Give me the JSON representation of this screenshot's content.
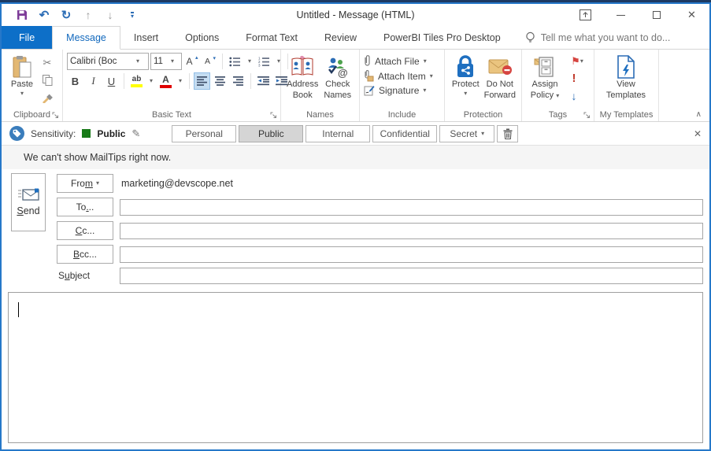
{
  "icons": {
    "dropdown": "▾",
    "undo": "↶",
    "redo": "↻",
    "up_arrow": "↑",
    "down_arrow": "↓",
    "qat_more": "▾",
    "close_window": "✕",
    "cut": "✂",
    "grow_font_letter": "A",
    "shrink_font_letter": "A",
    "grow_caret": "▴",
    "shrink_caret": "▾",
    "highlight_text": "ab",
    "font_color_letter": "A",
    "flag": "⚑",
    "high_importance": "!",
    "low_importance": "↓",
    "pencil": "✎",
    "close_bar": "✕",
    "collapse_ribbon": "∧"
  },
  "titlebar": {
    "title": "Untitled - Message (HTML)"
  },
  "tabs": {
    "file": "File",
    "message": "Message",
    "insert": "Insert",
    "options": "Options",
    "format_text": "Format Text",
    "review": "Review",
    "powerbi": "PowerBI Tiles Pro Desktop",
    "tell_me": "Tell me what you want to do..."
  },
  "ribbon": {
    "paste": "Paste",
    "clipboard_label": "Clipboard",
    "font_name": "Calibri (Boc",
    "font_size": "11",
    "bold": "B",
    "italic": "I",
    "underline": "U",
    "basic_text_label": "Basic Text",
    "address_book_1": "Address",
    "address_book_2": "Book",
    "check_names_1": "Check",
    "check_names_2": "Names",
    "names_label": "Names",
    "attach_file": "Attach File",
    "attach_item": "Attach Item",
    "signature": "Signature",
    "include_label": "Include",
    "protect": "Protect",
    "do_not_forward_1": "Do Not",
    "do_not_forward_2": "Forward",
    "protection_label": "Protection",
    "assign_policy_1": "Assign",
    "assign_policy_2": "Policy",
    "tags_label": "Tags",
    "view_templates_1": "View",
    "view_templates_2": "Templates",
    "my_templates_label": "My Templates"
  },
  "sensitivity": {
    "label": "Sensitivity:",
    "value": "Public",
    "selected": "Public",
    "options": [
      "Personal",
      "Public",
      "Internal",
      "Confidential",
      "Secret"
    ]
  },
  "mailtips": "We can't show MailTips right now.",
  "compose": {
    "send": {
      "pre": "",
      "u": "S",
      "post": "end"
    },
    "from": {
      "pre": "Fro",
      "u": "m",
      "post": ""
    },
    "from_value": "marketing@devscope.net",
    "to": {
      "pre": "To",
      "u": ".",
      "post": ".."
    },
    "cc": {
      "pre": "",
      "u": "C",
      "post": "c..."
    },
    "bcc": {
      "pre": "",
      "u": "B",
      "post": "cc..."
    },
    "subject": {
      "pre": "S",
      "u": "u",
      "post": "bject"
    },
    "to_value": "",
    "cc_value": "",
    "bcc_value": "",
    "subject_value": "",
    "body_value": ""
  }
}
